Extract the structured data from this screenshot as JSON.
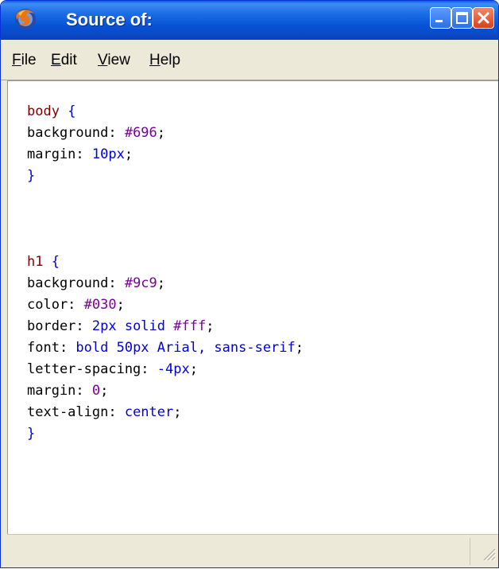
{
  "window": {
    "title": "Source of:",
    "app_icon": "firefox-icon",
    "controls": [
      "minimize-icon",
      "maximize-icon",
      "close-icon"
    ]
  },
  "menu": {
    "items": [
      "File",
      "Edit",
      "View",
      "Help"
    ]
  },
  "source": {
    "lines": [
      [
        {
          "t": "body",
          "c": "sel"
        },
        {
          "t": " ",
          "c": "prop"
        },
        {
          "t": "{",
          "c": "punct"
        }
      ],
      [
        {
          "t": "background: ",
          "c": "prop"
        },
        {
          "t": "#696",
          "c": "val"
        },
        {
          "t": ";",
          "c": "prop"
        }
      ],
      [
        {
          "t": "margin: ",
          "c": "prop"
        },
        {
          "t": "10px",
          "c": "unit"
        },
        {
          "t": ";",
          "c": "prop"
        }
      ],
      [
        {
          "t": "}",
          "c": "punct"
        }
      ],
      [],
      [],
      [],
      [
        {
          "t": "h1",
          "c": "sel"
        },
        {
          "t": " ",
          "c": "prop"
        },
        {
          "t": "{",
          "c": "punct"
        }
      ],
      [
        {
          "t": "background: ",
          "c": "prop"
        },
        {
          "t": "#9c9",
          "c": "val"
        },
        {
          "t": ";",
          "c": "prop"
        }
      ],
      [
        {
          "t": "color: ",
          "c": "prop"
        },
        {
          "t": "#030",
          "c": "val"
        },
        {
          "t": ";",
          "c": "prop"
        }
      ],
      [
        {
          "t": "border: ",
          "c": "prop"
        },
        {
          "t": "2px solid ",
          "c": "kw"
        },
        {
          "t": "#fff",
          "c": "val"
        },
        {
          "t": ";",
          "c": "prop"
        }
      ],
      [
        {
          "t": "font: ",
          "c": "prop"
        },
        {
          "t": "bold 50px Arial, sans-serif",
          "c": "kw"
        },
        {
          "t": ";",
          "c": "prop"
        }
      ],
      [
        {
          "t": "letter-spacing: ",
          "c": "prop"
        },
        {
          "t": "-4px",
          "c": "unit"
        },
        {
          "t": ";",
          "c": "prop"
        }
      ],
      [
        {
          "t": "margin: ",
          "c": "prop"
        },
        {
          "t": "0",
          "c": "val"
        },
        {
          "t": ";",
          "c": "prop"
        }
      ],
      [
        {
          "t": "text-align: ",
          "c": "prop"
        },
        {
          "t": "center",
          "c": "kw"
        },
        {
          "t": ";",
          "c": "prop"
        }
      ],
      [
        {
          "t": "}",
          "c": "punct"
        }
      ]
    ]
  },
  "statusbar": {
    "text": "",
    "grip_icon": "resize-grip-icon"
  }
}
